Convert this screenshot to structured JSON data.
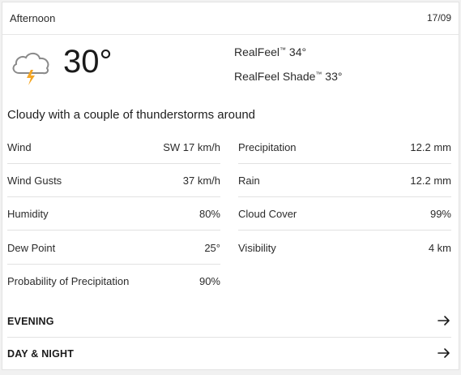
{
  "header": {
    "title": "Afternoon",
    "date": "17/09"
  },
  "current": {
    "temperature": "30°",
    "icon": "cloud-thunder-icon",
    "realfeel_label": "RealFeel",
    "realfeel_value": "34°",
    "realfeel_shade_label": "RealFeel Shade",
    "realfeel_shade_value": "33°",
    "phrase": "Cloudy with a couple of thunderstorms around"
  },
  "details_left": [
    {
      "label": "Wind",
      "value": "SW 17 km/h"
    },
    {
      "label": "Wind Gusts",
      "value": "37 km/h"
    },
    {
      "label": "Humidity",
      "value": "80%"
    },
    {
      "label": "Dew Point",
      "value": "25°"
    },
    {
      "label": "Probability of Precipitation",
      "value": "90%"
    }
  ],
  "details_right": [
    {
      "label": "Precipitation",
      "value": "12.2 mm"
    },
    {
      "label": "Rain",
      "value": "12.2 mm"
    },
    {
      "label": "Cloud Cover",
      "value": "99%"
    },
    {
      "label": "Visibility",
      "value": "4 km"
    }
  ],
  "links": [
    {
      "label": "EVENING",
      "icon": "arrow-right-icon"
    },
    {
      "label": "DAY & NIGHT",
      "icon": "arrow-right-icon"
    }
  ],
  "colors": {
    "bolt": "#f5a623",
    "cloud_stroke": "#8a8a8a",
    "divider": "#e2e2e2"
  }
}
